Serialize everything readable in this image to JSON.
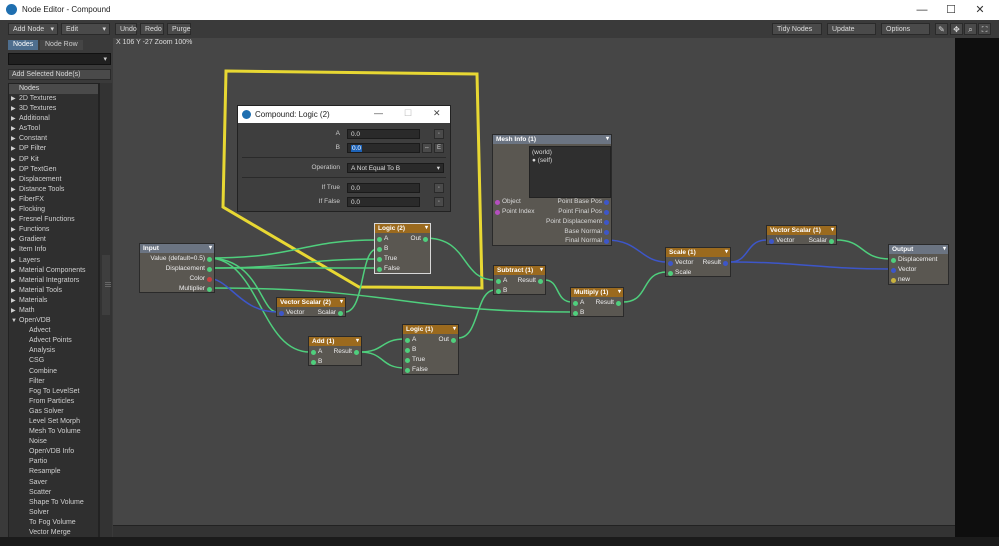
{
  "window": {
    "title": "Node Editor - Compound"
  },
  "toolbar": {
    "add_node": "Add Node",
    "edit": "Edit",
    "undo": "Undo",
    "redo": "Redo",
    "purge": "Purge",
    "tidy_nodes": "Tidy Nodes",
    "update": "Update",
    "options": "Options"
  },
  "sidebar": {
    "tab_nodes": "Nodes",
    "tab_node_row": "Node Row",
    "add_selected": "Add Selected Node(s)",
    "list_header": "Nodes",
    "categories": [
      "2D Textures",
      "3D Textures",
      "Additional",
      "AsTool",
      "Constant",
      "DP Filter",
      "DP Kit",
      "DP TextGen",
      "Displacement",
      "Distance Tools",
      "FiberFX",
      "Flocking",
      "Fresnel Functions",
      "Functions",
      "Gradient",
      "Item Info",
      "Layers",
      "Material Components",
      "Material Integrators",
      "Material Tools",
      "Materials",
      "Math",
      "OpenVDB"
    ],
    "openvdb_items": [
      "Advect",
      "Advect Points",
      "Analysis",
      "CSG",
      "Combine",
      "Filter",
      "Fog To LevelSet",
      "From Particles",
      "Gas Solver",
      "Level Set Morph",
      "Mesh To Volume",
      "Noise",
      "OpenVDB Info",
      "Partio",
      "Resample",
      "Saver",
      "Scatter",
      "Shape To Volume",
      "Solver",
      "To Fog Volume",
      "Vector Merge"
    ]
  },
  "canvas": {
    "coords": "X 106 Y -27 Zoom 100%"
  },
  "dialog": {
    "title": "Compound: Logic (2)",
    "a_label": "A",
    "a_value": "0.0",
    "b_label": "B",
    "b_value": "0.0",
    "operation_label": "Operation",
    "operation_value": "A Not Equal To B",
    "iftrue_label": "If True",
    "iftrue_value": "0.0",
    "iffalse_label": "If False",
    "iffalse_value": "0.0",
    "env_btn": "E"
  },
  "nodes": {
    "input": {
      "title": "Input",
      "value": "Value (default=0.5)",
      "displacement": "Displacement",
      "color": "Color",
      "multiplier": "Multiplier"
    },
    "logic2": {
      "title": "Logic (2)",
      "a": "A",
      "out": "Out",
      "b": "B",
      "true": "True",
      "false": "False"
    },
    "vecscalar2": {
      "title": "Vector Scalar (2)",
      "vector": "Vector",
      "scalar": "Scalar"
    },
    "add1": {
      "title": "Add (1)",
      "a": "A",
      "result": "Result",
      "b": "B"
    },
    "logic1": {
      "title": "Logic (1)",
      "a": "A",
      "out": "Out",
      "b": "B",
      "true": "True",
      "false": "False"
    },
    "subtract1": {
      "title": "Subtract (1)",
      "a": "A",
      "result": "Result",
      "b": "B"
    },
    "multiply1": {
      "title": "Multiply (1)",
      "a": "A",
      "result": "Result",
      "b": "B"
    },
    "meshinfo1": {
      "title": "Mesh Info (1)",
      "world": "(world)",
      "self": "(self)",
      "object": "Object",
      "pointbase": "Point Base Pos",
      "pointindex": "Point Index",
      "pointfinal": "Point Final Pos",
      "pointdisp": "Point Displacement",
      "basenormal": "Base Normal",
      "finalnormal": "Final Normal"
    },
    "scale1": {
      "title": "Scale (1)",
      "vector": "Vector",
      "result": "Result",
      "scale": "Scale"
    },
    "vecscalar1": {
      "title": "Vector Scalar (1)",
      "vector": "Vector",
      "scalar": "Scalar"
    },
    "output": {
      "title": "Output",
      "displacement": "Displacement",
      "vector": "Vector",
      "new": "new"
    }
  },
  "colors": {
    "highlight": "#e8d833",
    "node_header": "#9b6a1e",
    "wire_green": "#4fcf7d",
    "wire_blue": "#3d56c9"
  }
}
